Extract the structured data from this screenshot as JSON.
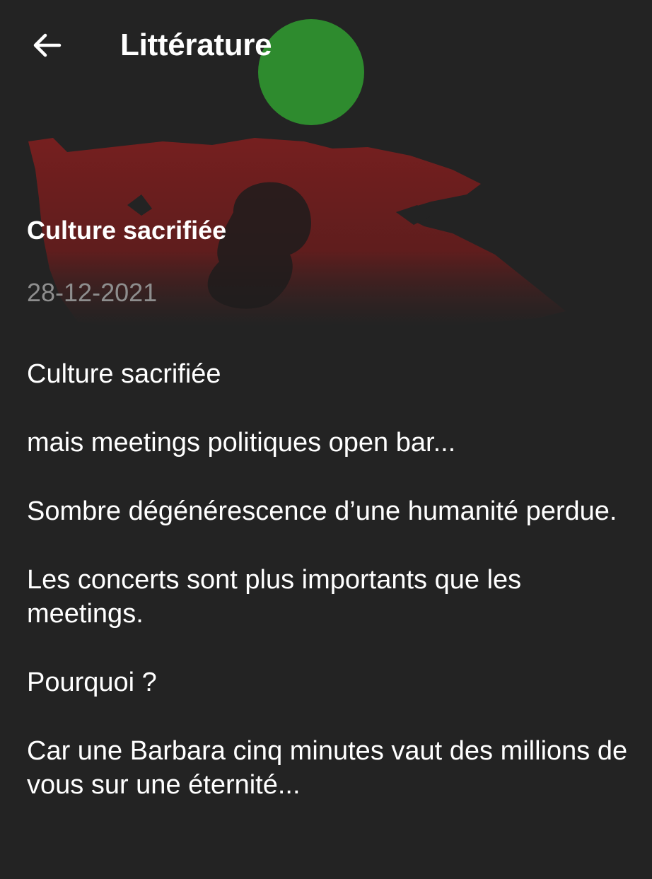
{
  "app_bar": {
    "title": "Littérature",
    "back_icon": "arrow-left-icon"
  },
  "header_image": {
    "description_icon": "flag-artwork",
    "colors": {
      "circle": "#2e8b2e",
      "flag": "#7a1f1f",
      "silhouette": "#1e1e1e"
    }
  },
  "article": {
    "title": "Culture sacrifiée",
    "date": "28-12-2021",
    "paragraphs": [
      "Culture sacrifiée",
      "mais meetings politiques open bar...",
      "Sombre dégénérescence d’une humanité perdue.",
      "Les concerts sont plus importants que les meetings.",
      "Pourquoi ?",
      "Car une Barbara cinq minutes vaut des millions de vous sur une éternité..."
    ]
  },
  "colors": {
    "background": "#232323",
    "text": "#ffffff",
    "date_text": "#8e8e8e"
  }
}
